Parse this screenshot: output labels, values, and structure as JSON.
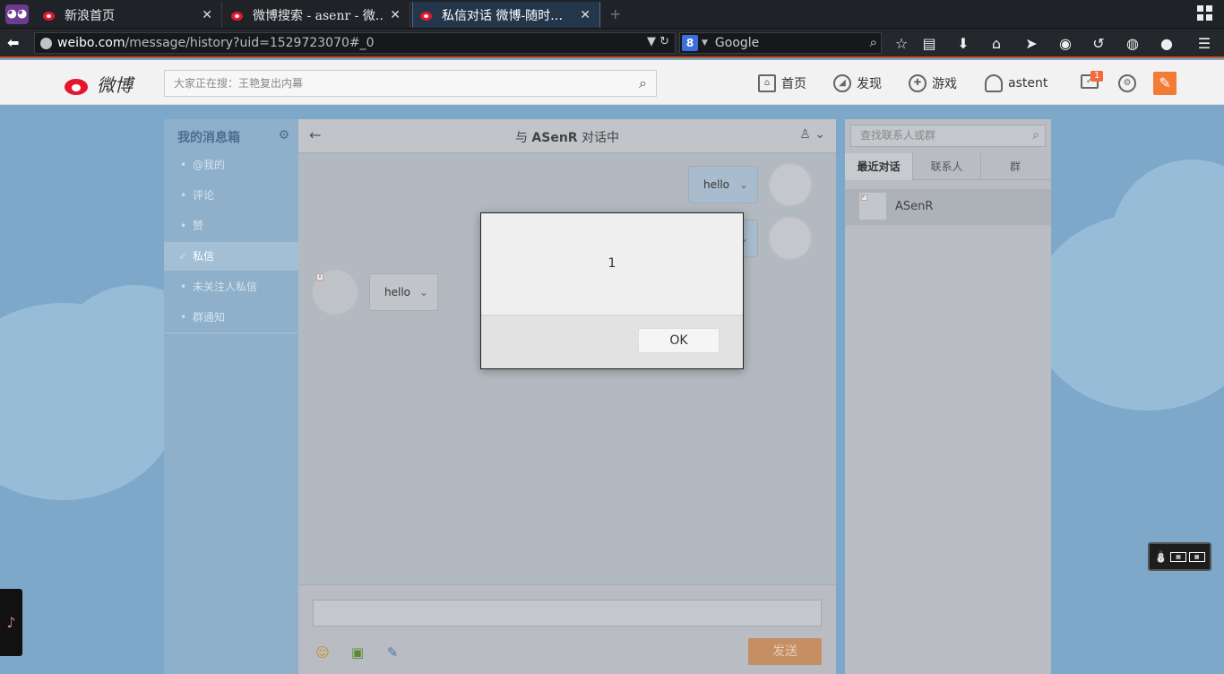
{
  "browser": {
    "tabs": [
      {
        "title": "新浪首页",
        "close": "✕"
      },
      {
        "title": "微博搜索 - asenr - 微…",
        "close": "✕"
      },
      {
        "title": "私信对话 微博-随时…",
        "close": "✕"
      }
    ],
    "new_tab": "+",
    "url_host": "weibo.com",
    "url_path": "/message/history?uid=1529723070#_0",
    "search_engine_badge": "8",
    "search_placeholder": "Google"
  },
  "weibo": {
    "logo_text": "微博",
    "search_placeholder": "大家正在搜：王艳复出内幕",
    "nav": {
      "home": "首页",
      "discover": "发现",
      "games": "游戏",
      "user": "astent"
    },
    "message_badge": "1"
  },
  "left_panel": {
    "title": "我的消息箱",
    "items": [
      "@我的",
      "评论",
      "赞",
      "私信",
      "未关注人私信",
      "群通知"
    ],
    "active_index": 3
  },
  "chat": {
    "title_prefix": "与 ",
    "title_name": "ASenR",
    "title_suffix": " 对话中",
    "messages": [
      {
        "side": "right",
        "text": "hello"
      },
      {
        "side": "right",
        "text": ""
      },
      {
        "side": "left",
        "text": "hello"
      }
    ],
    "send_label": "发送"
  },
  "right_panel": {
    "search_placeholder": "查找联系人或群",
    "tabs": [
      "最近对话",
      "联系人",
      "群"
    ],
    "active_tab": 0,
    "contacts": [
      {
        "name": "ASenR"
      }
    ]
  },
  "dialog": {
    "message": "1",
    "ok_label": "OK"
  },
  "colors": {
    "weibo_red": "#e6162d",
    "accent_orange": "#f47b35",
    "browser_dark": "#1f2328"
  }
}
